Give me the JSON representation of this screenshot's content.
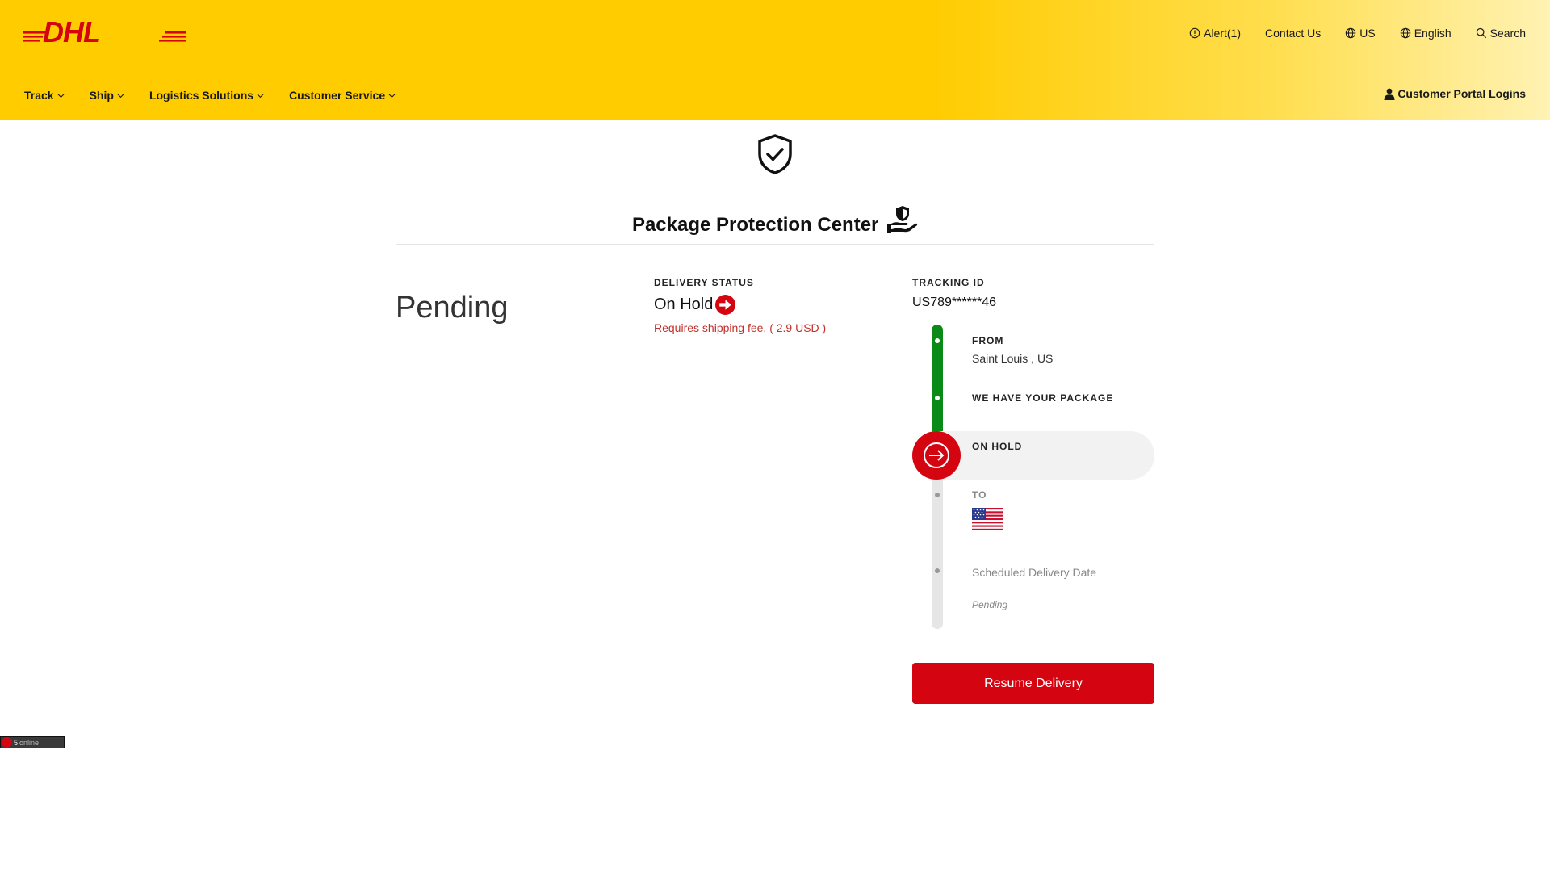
{
  "header": {
    "logo_text": "DHL",
    "utility": {
      "alert": "Alert(1)",
      "contact": "Contact Us",
      "country": "US",
      "language": "English",
      "search": "Search"
    },
    "nav": [
      "Track",
      "Ship",
      "Logistics Solutions",
      "Customer Service"
    ],
    "portal": "Customer Portal Logins"
  },
  "page": {
    "title": "Package Protection Center",
    "status_big": "Pending"
  },
  "delivery": {
    "label": "DELIVERY STATUS",
    "value": "On Hold",
    "note": "Requires shipping fee. ( 2.9 USD )"
  },
  "tracking": {
    "label": "TRACKING ID",
    "id": "US789******46"
  },
  "timeline": {
    "from_label": "FROM",
    "from_value": "Saint Louis , US",
    "have_label": "WE HAVE YOUR PACKAGE",
    "hold_label": "ON HOLD",
    "to_label": "TO",
    "to_country": "US",
    "scheduled_label": "Scheduled Delivery Date",
    "scheduled_value": "Pending"
  },
  "actions": {
    "resume": "Resume Delivery"
  },
  "online_badge": {
    "count": "5",
    "word": "online"
  },
  "colors": {
    "brand_yellow": "#ffcc00",
    "brand_red": "#d40511",
    "progress_green": "#0a8a17"
  },
  "icons": {
    "alert": "alert-circle-icon",
    "globe": "globe-icon",
    "search": "search-icon",
    "chevron": "chevron-down-icon",
    "user": "user-icon",
    "shield": "shield-check-icon",
    "hand_shield": "hand-shield-icon",
    "arrow": "arrow-right-circle-icon",
    "flag": "us-flag-icon"
  }
}
